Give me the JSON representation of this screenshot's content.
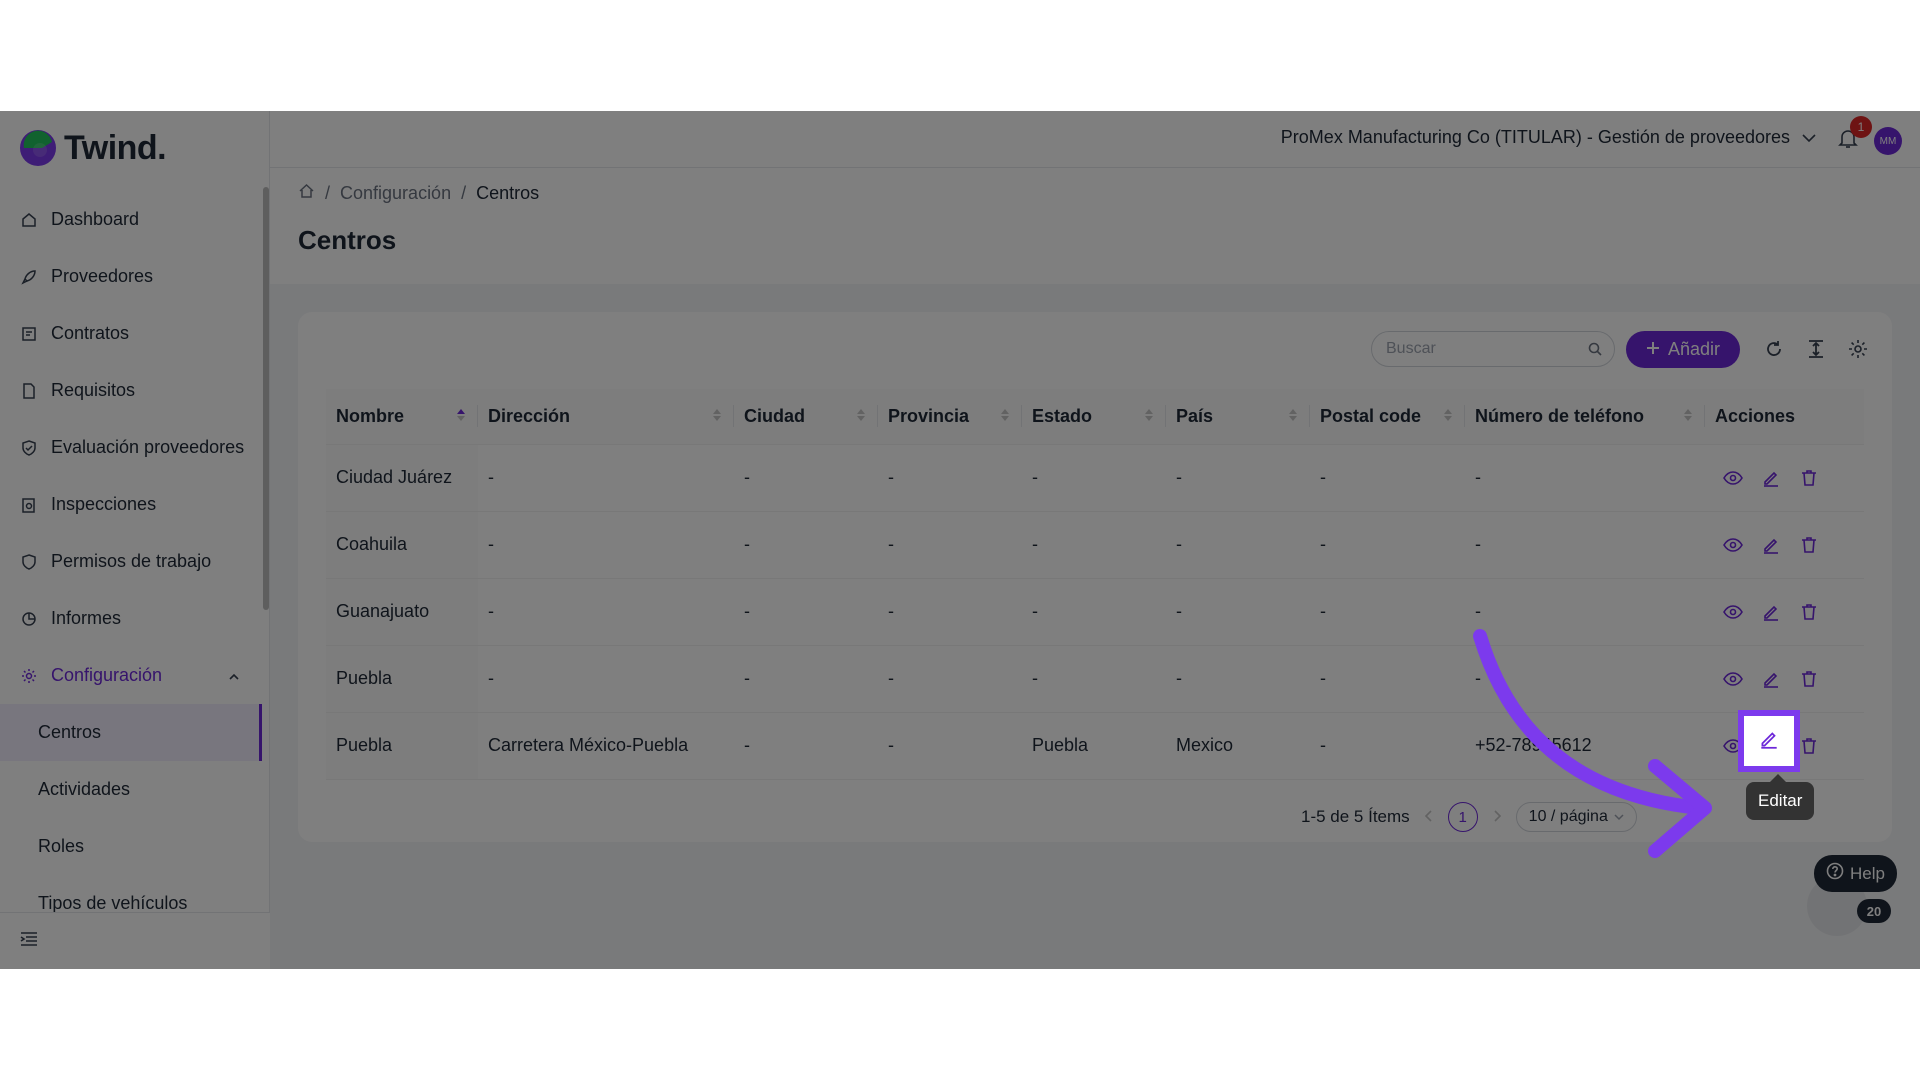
{
  "app": {
    "name": "Twind."
  },
  "sidebar": {
    "items": [
      {
        "label": "Dashboard",
        "icon": "home-icon"
      },
      {
        "label": "Proveedores",
        "icon": "rocket-icon"
      },
      {
        "label": "Contratos",
        "icon": "contract-icon"
      },
      {
        "label": "Requisitos",
        "icon": "document-icon"
      },
      {
        "label": "Evaluación proveedores",
        "icon": "shield-check-icon"
      },
      {
        "label": "Inspecciones",
        "icon": "clipboard-search-icon"
      },
      {
        "label": "Permisos de trabajo",
        "icon": "shield-icon"
      },
      {
        "label": "Informes",
        "icon": "pie-chart-icon"
      },
      {
        "label": "Configuración",
        "icon": "gear-icon"
      }
    ],
    "subitems": [
      "Centros",
      "Actividades",
      "Roles",
      "Tipos de vehículos"
    ]
  },
  "topbar": {
    "organization": "ProMex Manufacturing Co (TITULAR) - Gestión de proveedores",
    "notifications": "1",
    "avatar_initials": "MM"
  },
  "breadcrumb": {
    "level1": "Configuración",
    "level2": "Centros",
    "separator": "/"
  },
  "page": {
    "title": "Centros"
  },
  "toolbar": {
    "search_placeholder": "Buscar",
    "add_label": "Añadir"
  },
  "table": {
    "headers": [
      "Nombre",
      "Dirección",
      "Ciudad",
      "Provincia",
      "Estado",
      "País",
      "Postal code",
      "Número de teléfono",
      "Acciones"
    ],
    "rows": [
      [
        "Ciudad Juárez",
        "-",
        "-",
        "-",
        "-",
        "-",
        "-",
        "-"
      ],
      [
        "Coahuila",
        "-",
        "-",
        "-",
        "-",
        "-",
        "-",
        "-"
      ],
      [
        "Guanajuato",
        "-",
        "-",
        "-",
        "-",
        "-",
        "-",
        "-"
      ],
      [
        "Puebla",
        "-",
        "-",
        "-",
        "-",
        "-",
        "-",
        "-"
      ],
      [
        "Puebla",
        "Carretera México-Puebla",
        "-",
        "-",
        "Puebla",
        "Mexico",
        "-",
        "+52-78945612"
      ]
    ]
  },
  "pagination": {
    "summary": "1-5 de 5 Ítems",
    "current_page": "1",
    "page_size": "10 / página"
  },
  "tooltip": {
    "label": "Editar"
  },
  "help": {
    "label": "Help",
    "count": "20"
  },
  "colors": {
    "brand": "#6d28d9",
    "highlight": "#7c3aed"
  }
}
